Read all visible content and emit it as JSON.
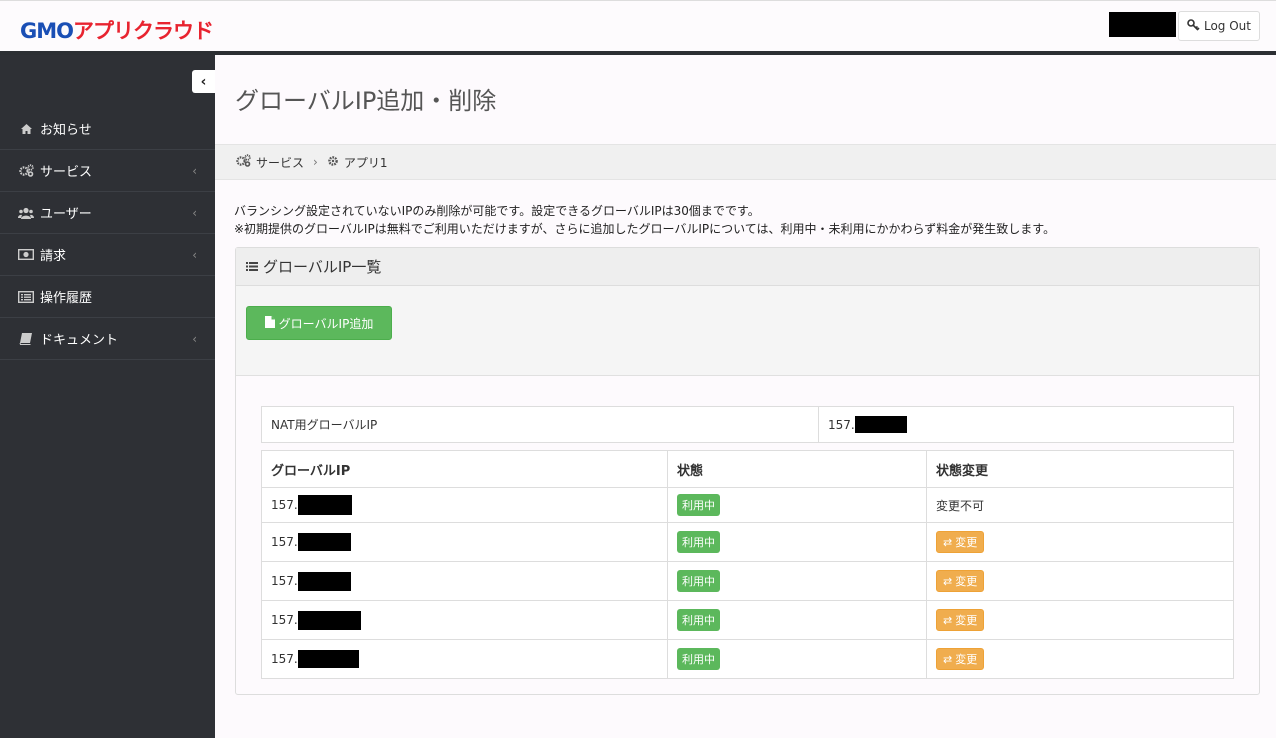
{
  "header": {
    "logo_gmo": "GMO",
    "logo_brand": "アプリクラウド",
    "logout_label": "Log Out"
  },
  "sidebar": {
    "collapse_glyph": "‹",
    "items": [
      {
        "label": "お知らせ",
        "icon": "home-icon",
        "has_children": false
      },
      {
        "label": "サービス",
        "icon": "cogs-icon",
        "has_children": true
      },
      {
        "label": "ユーザー",
        "icon": "users-icon",
        "has_children": true
      },
      {
        "label": "請求",
        "icon": "money-icon",
        "has_children": true
      },
      {
        "label": "操作履歴",
        "icon": "list-alt-icon",
        "has_children": false
      },
      {
        "label": "ドキュメント",
        "icon": "book-icon",
        "has_children": true
      }
    ]
  },
  "main": {
    "title": "グローバルIP追加・削除",
    "breadcrumb": [
      {
        "label": "サービス",
        "icon": "cogs-icon"
      },
      {
        "label": "アプリ1",
        "icon": "cog-icon"
      }
    ],
    "notes": [
      "バランシング設定されていないIPのみ削除が可能です。設定できるグローバルIPは30個までです。",
      "※初期提供のグローバルIPは無料でご利用いただけますが、さらに追加したグローバルIPについては、利用中・未利用にかかわらず料金が発生致します。"
    ],
    "panel": {
      "title": "グローバルIP一覧",
      "add_button_label": "グローバルIP追加",
      "nat": {
        "label": "NAT用グローバルIP",
        "value_prefix": "157."
      },
      "columns": [
        "グローバルIP",
        "状態",
        "状態変更"
      ],
      "rows": [
        {
          "ip_prefix": "157.",
          "status": "利用中",
          "action_type": "text",
          "action": "変更不可"
        },
        {
          "ip_prefix": "157.",
          "status": "利用中",
          "action_type": "button",
          "action": "変更"
        },
        {
          "ip_prefix": "157.",
          "status": "利用中",
          "action_type": "button",
          "action": "変更"
        },
        {
          "ip_prefix": "157.",
          "status": "利用中",
          "action_type": "button",
          "action": "変更"
        },
        {
          "ip_prefix": "157.",
          "status": "利用中",
          "action_type": "button",
          "action": "変更"
        }
      ]
    }
  },
  "colors": {
    "sidebar_bg": "#2e3035",
    "success": "#5cb85c",
    "warning": "#f0ad4e",
    "logo_blue": "#1a4fb5",
    "logo_red": "#e8232f"
  }
}
